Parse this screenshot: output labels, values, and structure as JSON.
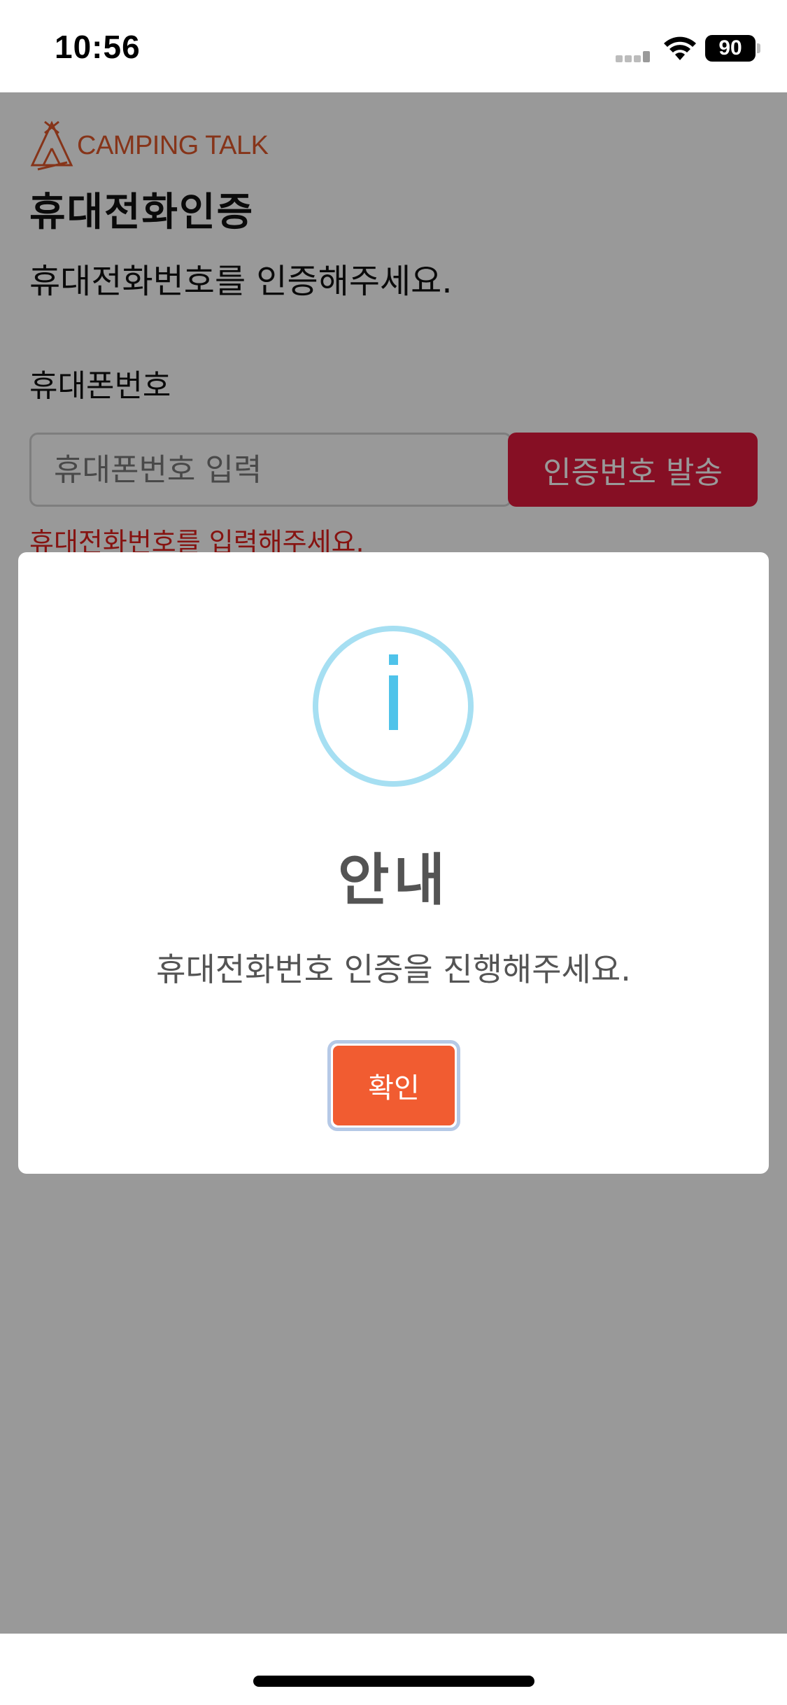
{
  "status_bar": {
    "time": "10:56",
    "battery": "90",
    "icons": [
      "cellular-signal-icon",
      "wifi-icon",
      "battery-icon"
    ]
  },
  "page": {
    "logo_text": "CAMPING TALK",
    "title": "휴대전화인증",
    "subtitle": "휴대전화번호를 인증해주세요.",
    "phone_label": "휴대폰번호",
    "phone_placeholder": "휴대폰번호 입력",
    "phone_value": "",
    "send_code_label": "인증번호 발송",
    "phone_error": "휴대전화번호를 입력해주세요."
  },
  "modal": {
    "icon": "info-icon",
    "title": "안내",
    "message": "휴대전화번호 인증을 진행해주세요.",
    "confirm_label": "확인"
  },
  "colors": {
    "brand": "#e0582a",
    "send_button": "#e01a3d",
    "error": "#e0201d",
    "confirm_button": "#f15c31",
    "info_icon": "#4fc3ea",
    "overlay": "rgba(0,0,0,0.4)"
  }
}
